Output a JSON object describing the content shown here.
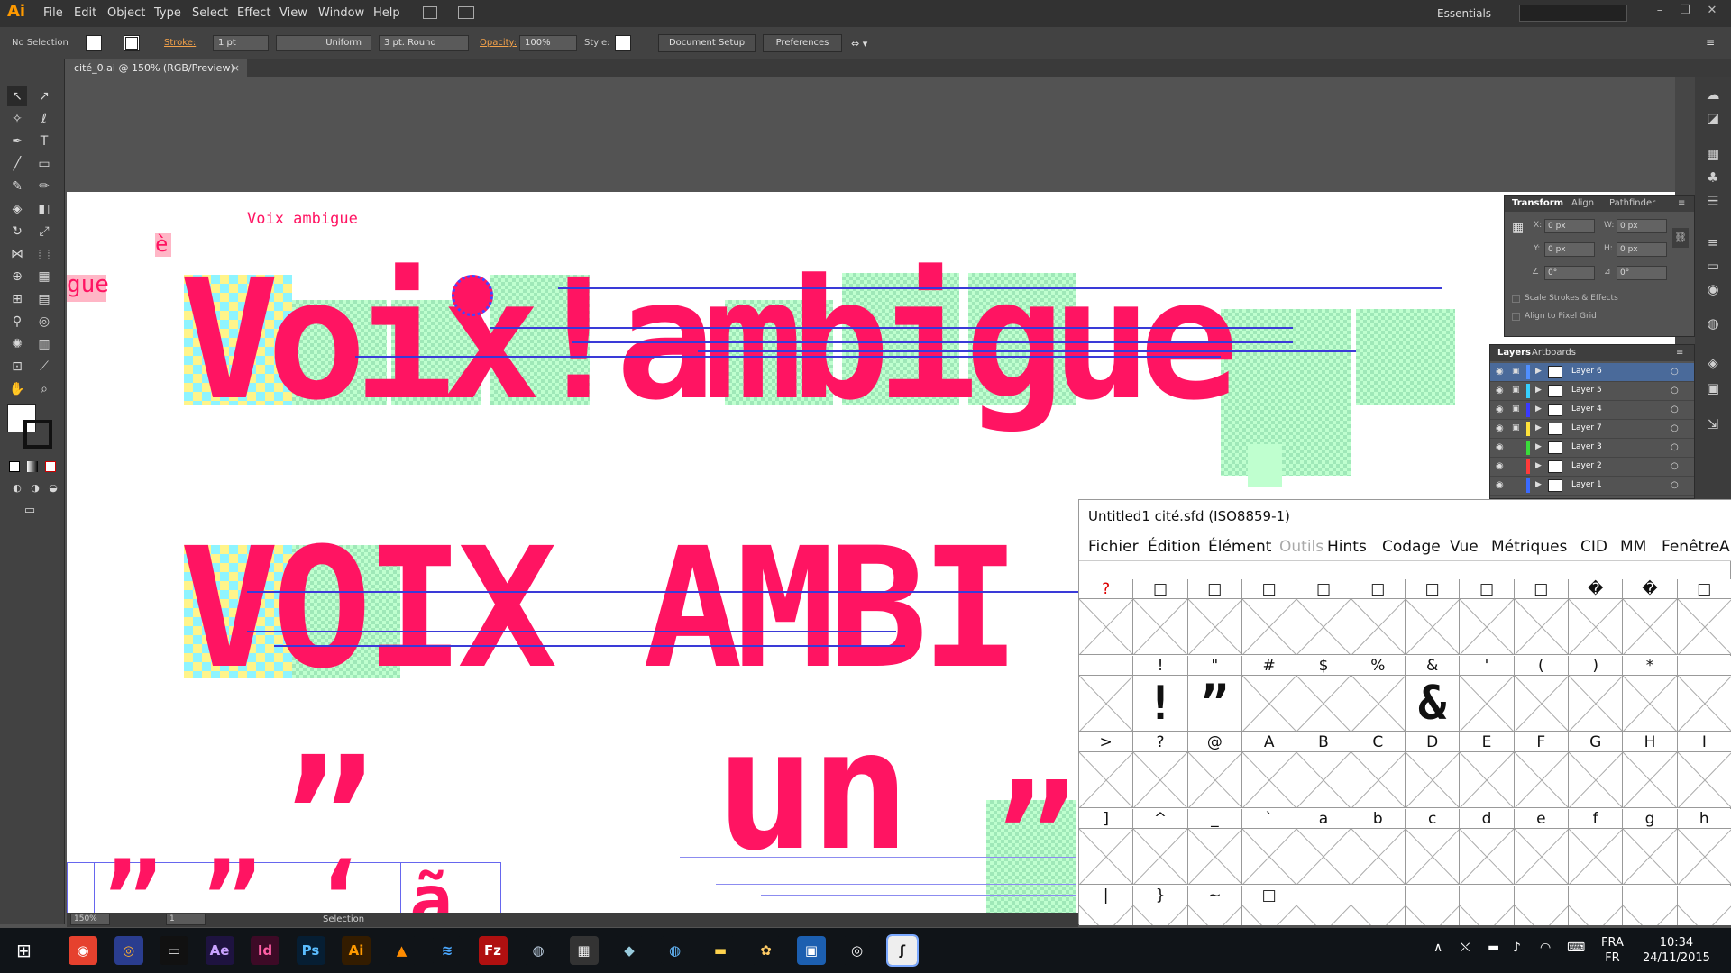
{
  "app": {
    "logo": "Ai",
    "menus": [
      "File",
      "Edit",
      "Object",
      "Type",
      "Select",
      "Effect",
      "View",
      "Window",
      "Help"
    ],
    "workspace": "Essentials"
  },
  "control": {
    "selection": "No Selection",
    "stroke_label": "Stroke:",
    "stroke_weight": "1 pt",
    "profile": "Uniform",
    "brush": "3 pt. Round",
    "opacity_label": "Opacity:",
    "opacity": "100%",
    "style_label": "Style:",
    "doc_setup": "Document Setup",
    "preferences": "Preferences"
  },
  "document": {
    "tab": "cité_0.ai @ 150% (RGB/Preview)",
    "zoom": "150%",
    "artboard_num": "1",
    "tool_status": "Selection"
  },
  "artwork": {
    "small_text": "Voix ambigue",
    "e_grave": "è",
    "gue_fragment": "gue",
    "line1": "Voix!ambigue",
    "line2": "VOIX AMBI",
    "line3": "un",
    "quote_big": "”",
    "bottom_glyphs": [
      "”",
      "”",
      "”",
      "‘",
      "ã"
    ]
  },
  "transform_panel": {
    "tabs": [
      "Transform",
      "Align",
      "Pathfinder"
    ],
    "x_label": "X:",
    "x_value": "0 px",
    "y_label": "Y:",
    "y_value": "0 px",
    "w_label": "W:",
    "w_value": "0 px",
    "h_label": "H:",
    "h_value": "0 px",
    "rotate_value": "0°",
    "shear_value": "0°",
    "scale_strokes": "Scale Strokes & Effects",
    "align_pixel": "Align to Pixel Grid"
  },
  "layers_panel": {
    "tabs": [
      "Layers",
      "Artboards"
    ],
    "layers": [
      {
        "name": "Layer 6",
        "color": "#4f8fff",
        "selected": true,
        "locked": true
      },
      {
        "name": "Layer 5",
        "color": "#36d0ff",
        "selected": false,
        "locked": true
      },
      {
        "name": "Layer 4",
        "color": "#3a3aff",
        "selected": false,
        "locked": true
      },
      {
        "name": "Layer 7",
        "color": "#ffe23a",
        "selected": false,
        "locked": true
      },
      {
        "name": "Layer 3",
        "color": "#3adc3a",
        "selected": false,
        "locked": false
      },
      {
        "name": "Layer 2",
        "color": "#ff3a3a",
        "selected": false,
        "locked": false
      },
      {
        "name": "Layer 1",
        "color": "#3a6aff",
        "selected": false,
        "locked": false
      }
    ]
  },
  "fontforge": {
    "title": "Untitled1  cité.sfd (ISO8859-1)",
    "menus": [
      "Fichier",
      "Édition",
      "Élément",
      "Outils",
      "Hints",
      "Codage",
      "Vue",
      "Métriques",
      "CID",
      "MM",
      "Fenêtre",
      "Ai"
    ],
    "disabled_menu": "Outils",
    "rows": [
      {
        "heads": [
          "?",
          "□",
          "□",
          "□",
          "□",
          "□",
          "□",
          "□",
          "□",
          "�",
          "�",
          "□"
        ],
        "glyphs": [
          "",
          "",
          "",
          "",
          "",
          "",
          "",
          "",
          "",
          "",
          "",
          ""
        ]
      },
      {
        "heads": [
          "",
          "!",
          "\"",
          "#",
          "$",
          "%",
          "&",
          "'",
          "(",
          ")",
          "*",
          ""
        ],
        "glyphs": [
          "",
          "!",
          "”",
          "",
          "",
          "",
          "&",
          "",
          "",
          "",
          "",
          ""
        ]
      },
      {
        "heads": [
          ">",
          "?",
          "@",
          "A",
          "B",
          "C",
          "D",
          "E",
          "F",
          "G",
          "H",
          "I"
        ],
        "glyphs": [
          "",
          "",
          "",
          "",
          "",
          "",
          "",
          "",
          "",
          "",
          "",
          ""
        ]
      },
      {
        "heads": [
          "]",
          "^",
          "_",
          "`",
          "a",
          "b",
          "c",
          "d",
          "e",
          "f",
          "g",
          "h"
        ],
        "glyphs": [
          "",
          "",
          "",
          "",
          "",
          "",
          "",
          "",
          "",
          "",
          "",
          ""
        ]
      },
      {
        "heads": [
          "|",
          "}",
          "~",
          "□",
          "",
          "",
          "",
          "",
          "",
          "",
          "",
          ""
        ],
        "glyphs": [
          "",
          "",
          "",
          "",
          "",
          "",
          "",
          "",
          "",
          "",
          "",
          ""
        ]
      }
    ]
  },
  "taskbar": {
    "apps": [
      "chrome",
      "firefox",
      "terminal",
      "Ae",
      "Id",
      "Ps",
      "Ai",
      "vlc",
      "mixer",
      "Fz",
      "steam",
      "calc",
      "notes",
      "tool",
      "folder",
      "paint",
      "ff1",
      "ff2",
      "fontforge"
    ],
    "lang_top": "FRA",
    "lang_bottom": "FR",
    "time": "10:34",
    "date": "24/11/2015"
  }
}
